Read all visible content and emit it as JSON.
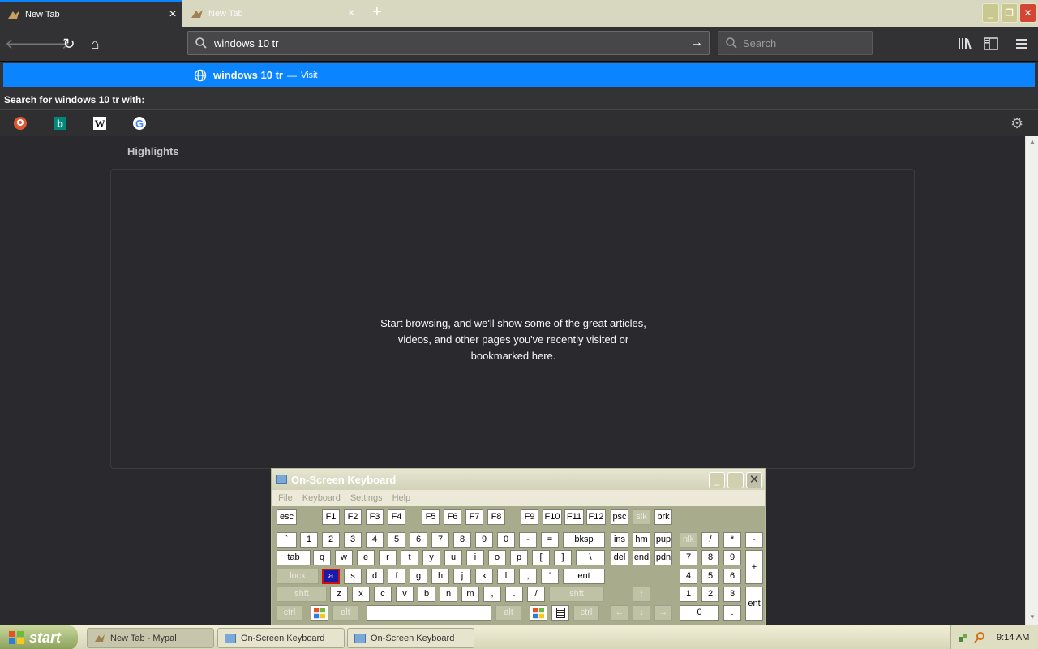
{
  "browser": {
    "tabs": [
      {
        "label": "New Tab",
        "active": true
      },
      {
        "label": "New Tab",
        "active": false
      }
    ],
    "new_tab_symbol": "+",
    "window_controls": {
      "minimize": "_",
      "maximize": "❐",
      "close": "✕"
    },
    "nav": {
      "back": "back-icon",
      "forward": "forward-icon",
      "reload": "reload-icon",
      "home": "home-icon"
    },
    "url_value": "windows 10 tr",
    "search_placeholder": "Search",
    "toolbar_icons": [
      "library-icon",
      "sidebar-icon",
      "menu-icon"
    ]
  },
  "url_popup": {
    "suggestion_text": "windows 10 tr",
    "suggestion_separator": "—",
    "suggestion_action": "Visit",
    "search_with_label": "Search for windows 10 tr with:",
    "engines": [
      "duckduckgo-icon",
      "bing-icon",
      "wikipedia-icon",
      "google-icon"
    ],
    "accent": "#0a84ff"
  },
  "content": {
    "highlights_title": "Highlights",
    "empty_lines": [
      "Start browsing, and we'll show some of the great articles,",
      "videos, and other pages you've recently visited or",
      "bookmarked here."
    ]
  },
  "osk": {
    "title": "On-Screen Keyboard",
    "menu": [
      "File",
      "Keyboard",
      "Settings",
      "Help"
    ],
    "rows": [
      [
        "esc",
        "F1",
        "F2",
        "F3",
        "F4",
        "F5",
        "F6",
        "F7",
        "F8",
        "F9",
        "F10",
        "F11",
        "F12",
        "psc",
        "slk",
        "brk"
      ],
      [
        "`",
        "1",
        "2",
        "3",
        "4",
        "5",
        "6",
        "7",
        "8",
        "9",
        "0",
        "-",
        "=",
        "bksp",
        "ins",
        "hm",
        "pup",
        "nlk",
        "/",
        "*",
        "-"
      ],
      [
        "tab",
        "q",
        "w",
        "e",
        "r",
        "t",
        "y",
        "u",
        "i",
        "o",
        "p",
        "[",
        "]",
        "\\",
        "del",
        "end",
        "pdn",
        "7",
        "8",
        "9",
        "+"
      ],
      [
        "lock",
        "a",
        "s",
        "d",
        "f",
        "g",
        "h",
        "j",
        "k",
        "l",
        ";",
        "'",
        "ent",
        "4",
        "5",
        "6"
      ],
      [
        "shft",
        "z",
        "x",
        "c",
        "v",
        "b",
        "n",
        "m",
        ",",
        ".",
        "/",
        "shft",
        "↑",
        "1",
        "2",
        "3",
        "ent"
      ],
      [
        "ctrl",
        "win",
        "alt",
        "space",
        "alt",
        "win",
        "menu",
        "ctrl",
        "←",
        "↓",
        "→",
        "0",
        "."
      ]
    ],
    "selected_key": "a"
  },
  "taskbar": {
    "start_label": "start",
    "buttons": [
      {
        "label": "New Tab - Mypal",
        "active": true
      },
      {
        "label": "On-Screen Keyboard",
        "active": false
      },
      {
        "label": "On-Screen Keyboard",
        "active": false
      }
    ],
    "clock": "9:14 AM"
  }
}
